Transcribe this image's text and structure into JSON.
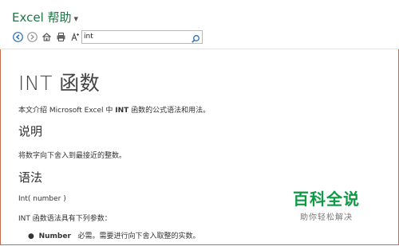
{
  "window": {
    "title": "Excel 帮助",
    "title_caret": "▾"
  },
  "toolbar": {
    "search_value": "int"
  },
  "article": {
    "heading": "INT 函数",
    "intro_pre": "本文介绍 Microsoft Excel 中 ",
    "intro_bold": "INT",
    "intro_post": " 函数的公式语法和用法。",
    "section_description": "说明",
    "description_text": "将数字向下舍入到最接近的整数。",
    "section_syntax": "语法",
    "syntax_signature": "Int( number )",
    "syntax_params_intro": "INT 函数语法具有下列参数：",
    "param_name": "Number",
    "param_desc": "必需。需要进行向下舍入取整的实数。"
  },
  "watermark": {
    "big": "百科全说",
    "small": "助你轻松解决"
  },
  "colors": {
    "accent": "#217346",
    "frame": "#c96b50",
    "watermark": "#0d9a45"
  }
}
